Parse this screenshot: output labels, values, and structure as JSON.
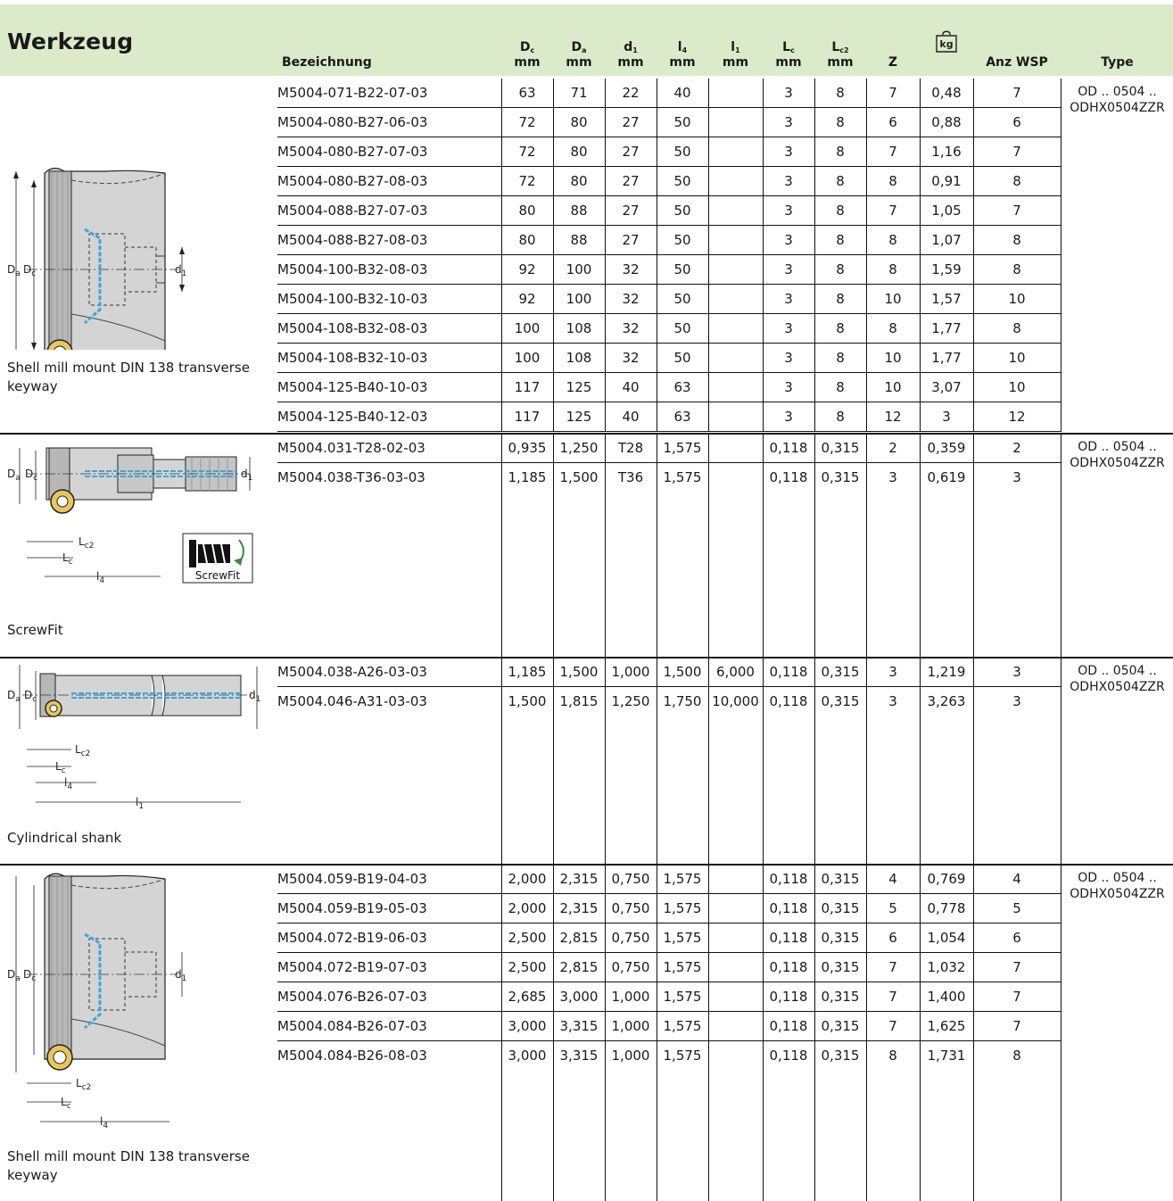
{
  "header": {
    "title": "Werkzeug",
    "columns": {
      "bez": "Bezeichnung",
      "dc_sym": "D",
      "dc_sub": "c",
      "dc_unit": "mm",
      "da_sym": "D",
      "da_sub": "a",
      "da_unit": "mm",
      "d1_sym": "d",
      "d1_sub": "1",
      "d1_unit": "mm",
      "l4_sym": "l",
      "l4_sub": "4",
      "l4_unit": "mm",
      "l1_sym": "l",
      "l1_sub": "1",
      "l1_unit": "mm",
      "lc_sym": "L",
      "lc_sub": "c",
      "lc_unit": "mm",
      "lc2_sym": "L",
      "lc2_sub": "c2",
      "lc2_unit": "mm",
      "z": "Z",
      "kg": "kg",
      "wsp": "Anz WSP",
      "type": "Type"
    }
  },
  "sections": [
    {
      "caption": "Shell mill mount DIN 138 transverse keyway",
      "type1": "OD .. 0504 ..",
      "type2": "ODHX0504ZZR",
      "rows": [
        [
          "M5004-071-B22-07-03",
          "63",
          "71",
          "22",
          "40",
          "",
          "3",
          "8",
          "7",
          "0,48",
          "7"
        ],
        [
          "M5004-080-B27-06-03",
          "72",
          "80",
          "27",
          "50",
          "",
          "3",
          "8",
          "6",
          "0,88",
          "6"
        ],
        [
          "M5004-080-B27-07-03",
          "72",
          "80",
          "27",
          "50",
          "",
          "3",
          "8",
          "7",
          "1,16",
          "7"
        ],
        [
          "M5004-080-B27-08-03",
          "72",
          "80",
          "27",
          "50",
          "",
          "3",
          "8",
          "8",
          "0,91",
          "8"
        ],
        [
          "M5004-088-B27-07-03",
          "80",
          "88",
          "27",
          "50",
          "",
          "3",
          "8",
          "7",
          "1,05",
          "7"
        ],
        [
          "M5004-088-B27-08-03",
          "80",
          "88",
          "27",
          "50",
          "",
          "3",
          "8",
          "8",
          "1,07",
          "8"
        ],
        [
          "M5004-100-B32-08-03",
          "92",
          "100",
          "32",
          "50",
          "",
          "3",
          "8",
          "8",
          "1,59",
          "8"
        ],
        [
          "M5004-100-B32-10-03",
          "92",
          "100",
          "32",
          "50",
          "",
          "3",
          "8",
          "10",
          "1,57",
          "10"
        ],
        [
          "M5004-108-B32-08-03",
          "100",
          "108",
          "32",
          "50",
          "",
          "3",
          "8",
          "8",
          "1,77",
          "8"
        ],
        [
          "M5004-108-B32-10-03",
          "100",
          "108",
          "32",
          "50",
          "",
          "3",
          "8",
          "10",
          "1,77",
          "10"
        ],
        [
          "M5004-125-B40-10-03",
          "117",
          "125",
          "40",
          "63",
          "",
          "3",
          "8",
          "10",
          "3,07",
          "10"
        ],
        [
          "M5004-125-B40-12-03",
          "117",
          "125",
          "40",
          "63",
          "",
          "3",
          "8",
          "12",
          "3",
          "12"
        ]
      ]
    },
    {
      "caption": "ScrewFit",
      "badge": "ScrewFit",
      "type1": "OD .. 0504 ..",
      "type2": "ODHX0504ZZR",
      "rows": [
        [
          "M5004.031-T28-02-03",
          "0,935",
          "1,250",
          "T28",
          "1,575",
          "",
          "0,118",
          "0,315",
          "2",
          "0,359",
          "2"
        ],
        [
          "M5004.038-T36-03-03",
          "1,185",
          "1,500",
          "T36",
          "1,575",
          "",
          "0,118",
          "0,315",
          "3",
          "0,619",
          "3"
        ]
      ]
    },
    {
      "caption": "Cylindrical shank",
      "type1": "OD .. 0504 ..",
      "type2": "ODHX0504ZZR",
      "rows": [
        [
          "M5004.038-A26-03-03",
          "1,185",
          "1,500",
          "1,000",
          "1,500",
          "6,000",
          "0,118",
          "0,315",
          "3",
          "1,219",
          "3"
        ],
        [
          "M5004.046-A31-03-03",
          "1,500",
          "1,815",
          "1,250",
          "1,750",
          "10,000",
          "0,118",
          "0,315",
          "3",
          "3,263",
          "3"
        ]
      ]
    },
    {
      "caption": "Shell mill mount DIN 138 transverse keyway",
      "type1": "OD .. 0504 ..",
      "type2": "ODHX0504ZZR",
      "rows": [
        [
          "M5004.059-B19-04-03",
          "2,000",
          "2,315",
          "0,750",
          "1,575",
          "",
          "0,118",
          "0,315",
          "4",
          "0,769",
          "4"
        ],
        [
          "M5004.059-B19-05-03",
          "2,000",
          "2,315",
          "0,750",
          "1,575",
          "",
          "0,118",
          "0,315",
          "5",
          "0,778",
          "5"
        ],
        [
          "M5004.072-B19-06-03",
          "2,500",
          "2,815",
          "0,750",
          "1,575",
          "",
          "0,118",
          "0,315",
          "6",
          "1,054",
          "6"
        ],
        [
          "M5004.072-B19-07-03",
          "2,500",
          "2,815",
          "0,750",
          "1,575",
          "",
          "0,118",
          "0,315",
          "7",
          "1,032",
          "7"
        ],
        [
          "M5004.076-B26-07-03",
          "2,685",
          "3,000",
          "1,000",
          "1,575",
          "",
          "0,118",
          "0,315",
          "7",
          "1,400",
          "7"
        ],
        [
          "M5004.084-B26-07-03",
          "3,000",
          "3,315",
          "1,000",
          "1,575",
          "",
          "0,118",
          "0,315",
          "7",
          "1,625",
          "7"
        ],
        [
          "M5004.084-B26-08-03",
          "3,000",
          "3,315",
          "1,000",
          "1,575",
          "",
          "0,118",
          "0,315",
          "8",
          "1,731",
          "8"
        ]
      ]
    }
  ],
  "diagram_labels": {
    "da": "D",
    "da_sub": "a",
    "dc": "D",
    "dc_sub": "c",
    "d1": "d",
    "d1_sub": "1",
    "lc2": "L",
    "lc2_sub": "c2",
    "lc": "L",
    "lc_sub": "c",
    "l4": "l",
    "l4_sub": "4",
    "l1": "l",
    "l1_sub": "1"
  }
}
